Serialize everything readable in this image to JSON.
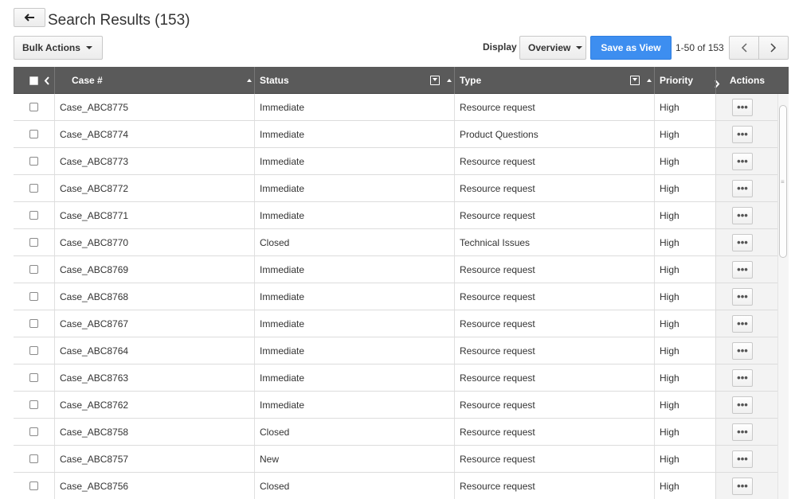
{
  "header": {
    "title": "Search Results (153)"
  },
  "toolbar": {
    "bulk_actions_label": "Bulk Actions",
    "display_label": "Display",
    "display_value": "Overview",
    "save_view_label": "Save as View",
    "page_range": "1-50 of 153"
  },
  "table": {
    "columns": {
      "case": "Case #",
      "status": "Status",
      "type": "Type",
      "priority": "Priority",
      "actions": "Actions"
    },
    "action_glyph": "•••",
    "rows": [
      {
        "case": "Case_ABC8775",
        "status": "Immediate",
        "type": "Resource request",
        "priority": "High"
      },
      {
        "case": "Case_ABC8774",
        "status": "Immediate",
        "type": "Product Questions",
        "priority": "High"
      },
      {
        "case": "Case_ABC8773",
        "status": "Immediate",
        "type": "Resource request",
        "priority": "High"
      },
      {
        "case": "Case_ABC8772",
        "status": "Immediate",
        "type": "Resource request",
        "priority": "High"
      },
      {
        "case": "Case_ABC8771",
        "status": "Immediate",
        "type": "Resource request",
        "priority": "High"
      },
      {
        "case": "Case_ABC8770",
        "status": "Closed",
        "type": "Technical Issues",
        "priority": "High"
      },
      {
        "case": "Case_ABC8769",
        "status": "Immediate",
        "type": "Resource request",
        "priority": "High"
      },
      {
        "case": "Case_ABC8768",
        "status": "Immediate",
        "type": "Resource request",
        "priority": "High"
      },
      {
        "case": "Case_ABC8767",
        "status": "Immediate",
        "type": "Resource request",
        "priority": "High"
      },
      {
        "case": "Case_ABC8764",
        "status": "Immediate",
        "type": "Resource request",
        "priority": "High"
      },
      {
        "case": "Case_ABC8763",
        "status": "Immediate",
        "type": "Resource request",
        "priority": "High"
      },
      {
        "case": "Case_ABC8762",
        "status": "Immediate",
        "type": "Resource request",
        "priority": "High"
      },
      {
        "case": "Case_ABC8758",
        "status": "Closed",
        "type": "Resource request",
        "priority": "High"
      },
      {
        "case": "Case_ABC8757",
        "status": "New",
        "type": "Resource request",
        "priority": "High"
      },
      {
        "case": "Case_ABC8756",
        "status": "Closed",
        "type": "Resource request",
        "priority": "High"
      }
    ]
  },
  "icons": {
    "back": "arrow-left-icon",
    "prev": "chevron-left-icon",
    "next": "chevron-right-icon",
    "filter": "filter-icon",
    "sort": "sort-asc-icon",
    "more": "more-horizontal-icon"
  },
  "colors": {
    "header_bg": "#5a5a5a",
    "primary": "#3d8ef0",
    "actions_col_bg": "#f3f3f3"
  }
}
